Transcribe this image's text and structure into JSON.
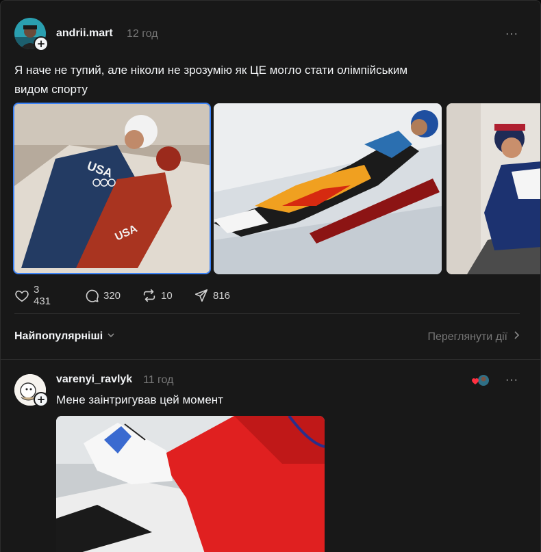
{
  "post": {
    "username": "andrii.mart",
    "time": "12 год",
    "more": "···",
    "text_line1": "Я наче не тупий, але ніколи не зрозумію як ЦЕ могло стати олімпійським",
    "text_line2": "видом спорту",
    "images": [
      {
        "description": "Two USA luge athletes lying on sled"
      },
      {
        "description": "Luge athlete in flame-patterned suit on sled"
      },
      {
        "description": "Luge athlete smiling in helmet"
      }
    ],
    "stats": {
      "likes": "3 431",
      "comments": "320",
      "reposts": "10",
      "shares": "816"
    }
  },
  "sort": {
    "label": "Найпопулярніші",
    "view_activity": "Переглянути дії"
  },
  "reply": {
    "username": "varenyi_ravlyk",
    "time": "11 год",
    "more": "···",
    "text": "Мене заінтригував цей момент"
  },
  "colors": {
    "background": "#181818",
    "text": "#f3f5f7",
    "muted": "#777777",
    "accent_like": "#ff3040"
  }
}
